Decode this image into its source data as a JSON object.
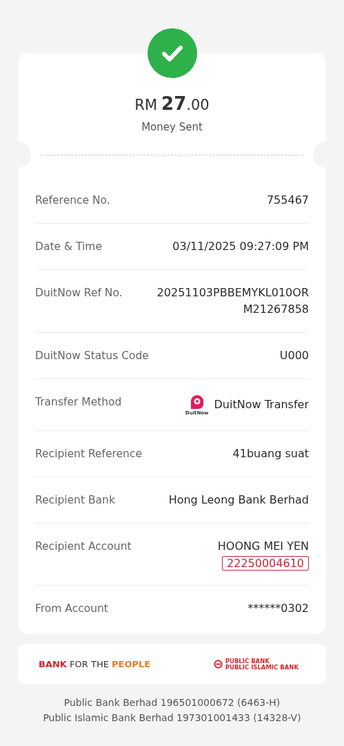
{
  "status": {
    "kind": "success"
  },
  "amount": {
    "currency": "RM",
    "whole": "27",
    "decimals": ".00"
  },
  "status_text": "Money Sent",
  "details": [
    {
      "kind": "text",
      "label": "Reference No.",
      "value": "755467"
    },
    {
      "kind": "text",
      "label": "Date & Time",
      "value": "03/11/2025 09:27:09 PM"
    },
    {
      "kind": "text",
      "label": "DuitNow Ref No.",
      "value": "20251103PBBEMYKL010ORM21267858"
    },
    {
      "kind": "text",
      "label": "DuitNow Status Code",
      "value": "U000"
    },
    {
      "kind": "method",
      "label": "Transfer Method",
      "logo_text": "DuitNow",
      "value": "DuitNow Transfer"
    },
    {
      "kind": "text",
      "label": "Recipient Reference",
      "value": "41buang suat"
    },
    {
      "kind": "text",
      "label": "Recipient Bank",
      "value": "Hong Leong Bank Berhad"
    },
    {
      "kind": "account",
      "label": "Recipient Account",
      "value": "HOONG MEI YEN",
      "account_number": "22250004610",
      "highlighted": true
    },
    {
      "kind": "text",
      "label": "From Account",
      "value": "******0302"
    }
  ],
  "banner": {
    "tagline": "**BANK** FOR THE **PEOPLE**",
    "logo_lines": [
      "PUBLIC BANK",
      "PUBLIC ISLAMIC BANK"
    ]
  },
  "footer": [
    "Public Bank Berhad 196501000672 (6463-H)",
    "Public Islamic Bank Berhad 197301001433 (14328-V)"
  ]
}
